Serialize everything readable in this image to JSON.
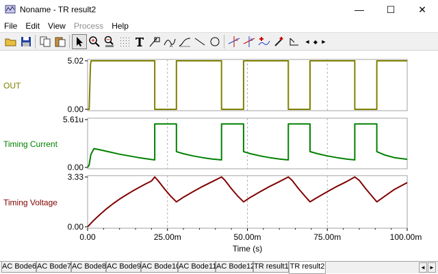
{
  "window": {
    "title": "Noname - TR result2",
    "minimize_glyph": "—",
    "maximize_glyph": "☐",
    "close_glyph": "✕"
  },
  "menu": [
    {
      "label": "File",
      "enabled": true
    },
    {
      "label": "Edit",
      "enabled": true
    },
    {
      "label": "View",
      "enabled": true
    },
    {
      "label": "Process",
      "enabled": false
    },
    {
      "label": "Help",
      "enabled": true
    }
  ],
  "toolbar": {
    "icons": [
      "open-folder-icon",
      "save-icon",
      "copy-icon",
      "paste-icon",
      "pointer-icon",
      "zoom-in-icon",
      "zoom-100-icon",
      "grid-icon",
      "text-tool-icon",
      "label-tool-icon",
      "curve-label-icon",
      "curve-tool-icon",
      "line-tool-icon",
      "circle-tool-icon",
      "cursor-a-icon",
      "cursor-b-icon",
      "cursor-add-icon",
      "pen-icon",
      "arrow-tool-icon"
    ],
    "scroll_glyphs": {
      "left": "◄",
      "updown": "◆",
      "right": "►"
    }
  },
  "chart_data": [
    {
      "type": "line",
      "ylabel": "OUT",
      "ylim": [
        0.0,
        5.02
      ],
      "ytick_labels": [
        "5.02",
        "0.00"
      ],
      "color": "#7f7f00",
      "x_ms": [
        0,
        0.5,
        0.9,
        1.1,
        21.0,
        21.0,
        27.8,
        27.8,
        41.9,
        41.9,
        48.8,
        48.8,
        62.8,
        62.8,
        69.6,
        69.6,
        83.6,
        83.6,
        90.5,
        90.5,
        100
      ],
      "values": [
        0.0,
        0.0,
        4.6,
        5.02,
        5.02,
        0.0,
        0.0,
        5.02,
        5.02,
        0.0,
        0.0,
        5.02,
        5.02,
        0.0,
        0.0,
        5.02,
        5.02,
        0.0,
        0.0,
        5.02,
        5.02
      ]
    },
    {
      "type": "line",
      "ylabel": "Timing Current",
      "ylim": [
        0.0,
        5.61
      ],
      "ytick_labels": [
        "5.61u",
        "0.00"
      ],
      "color": "#008000",
      "x_ms": [
        0,
        0.5,
        1.0,
        2.0,
        4,
        7,
        10,
        13,
        16,
        19,
        21.0,
        21.0,
        27.8,
        27.8,
        30,
        33,
        36,
        39,
        41.9,
        41.9,
        48.8,
        48.8,
        51,
        54,
        57,
        60,
        62.8,
        62.8,
        69.6,
        69.6,
        72,
        75,
        78,
        81,
        83.6,
        83.6,
        90.5,
        90.5,
        93,
        96,
        100
      ],
      "values": [
        0.0,
        0.3,
        1.5,
        2.2,
        2.05,
        1.8,
        1.55,
        1.35,
        1.15,
        0.98,
        0.88,
        5.1,
        5.1,
        1.85,
        1.6,
        1.35,
        1.15,
        0.98,
        0.88,
        5.1,
        5.1,
        1.85,
        1.6,
        1.35,
        1.15,
        0.98,
        0.88,
        5.1,
        5.1,
        1.85,
        1.6,
        1.35,
        1.15,
        0.98,
        0.88,
        5.1,
        5.1,
        1.85,
        1.45,
        1.15,
        0.95
      ]
    },
    {
      "type": "line",
      "ylabel": "Timing Voltage",
      "ylim": [
        0.0,
        3.33
      ],
      "ytick_labels": [
        "3.33",
        "0.00"
      ],
      "color": "#800000",
      "xlabel": "Time (s)",
      "xlim": [
        0,
        100
      ],
      "xtick_labels": [
        "0.00",
        "25.00m",
        "50.00m",
        "75.00m",
        "100.00m"
      ],
      "x_ms": [
        0,
        2,
        4,
        6,
        8,
        10,
        12,
        14,
        16,
        18,
        20,
        21.0,
        22,
        24,
        26,
        27.8,
        30,
        33,
        36,
        39,
        41.9,
        43,
        45,
        47,
        48.8,
        51,
        54,
        57,
        60,
        62.8,
        64,
        66,
        68,
        69.6,
        72,
        75,
        78,
        81,
        83.6,
        85,
        87,
        89,
        90.5,
        93,
        96,
        100
      ],
      "values": [
        0.0,
        0.45,
        0.85,
        1.22,
        1.55,
        1.85,
        2.12,
        2.38,
        2.62,
        2.85,
        3.06,
        3.33,
        3.1,
        2.55,
        2.05,
        1.67,
        1.98,
        2.35,
        2.7,
        3.02,
        3.33,
        3.1,
        2.55,
        2.05,
        1.67,
        1.98,
        2.35,
        2.7,
        3.02,
        3.33,
        3.1,
        2.55,
        2.05,
        1.67,
        1.98,
        2.35,
        2.7,
        3.02,
        3.33,
        3.1,
        2.55,
        2.05,
        1.67,
        2.05,
        2.5,
        2.95
      ]
    }
  ],
  "tabs": [
    "AC Bode6",
    "AC Bode7",
    "AC Bode8",
    "AC Bode9",
    "AC Bode10",
    "AC Bode11",
    "AC Bode12",
    "TR result1",
    "TR result2"
  ],
  "active_tab": 8,
  "tab_scroll": {
    "left": "◄",
    "right": "►"
  }
}
